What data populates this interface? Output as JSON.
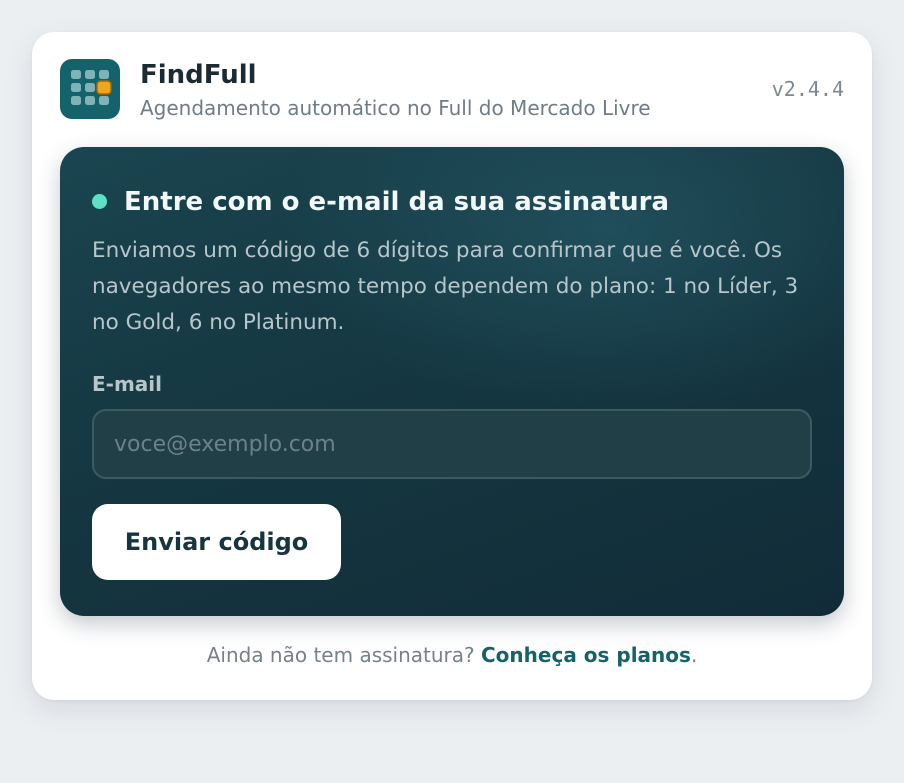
{
  "header": {
    "logo_icon": "calendar-grid-icon",
    "app_name": "FindFull",
    "subtitle": "Agendamento automático no Full do Mercado Livre",
    "version": "v2.4.4"
  },
  "login": {
    "status_icon": "status-dot-icon",
    "title": "Entre com o e-mail da sua assinatura",
    "description": "Enviamos um código de 6 dígitos para confirmar que é você. Os navegadores ao mesmo tempo dependem do plano: 1 no Líder, 3 no Gold, 6 no Platinum.",
    "email_label": "E-mail",
    "email_placeholder": "voce@exemplo.com",
    "email_value": "",
    "submit_label": "Enviar código"
  },
  "footer": {
    "text": "Ainda não tem assinatura? ",
    "link_label": "Conheça os planos",
    "suffix": "."
  },
  "colors": {
    "accent": "#14636b",
    "panel": "#153741",
    "status_dot": "#5ee0c6",
    "logo_highlight": "#f0a51c"
  }
}
